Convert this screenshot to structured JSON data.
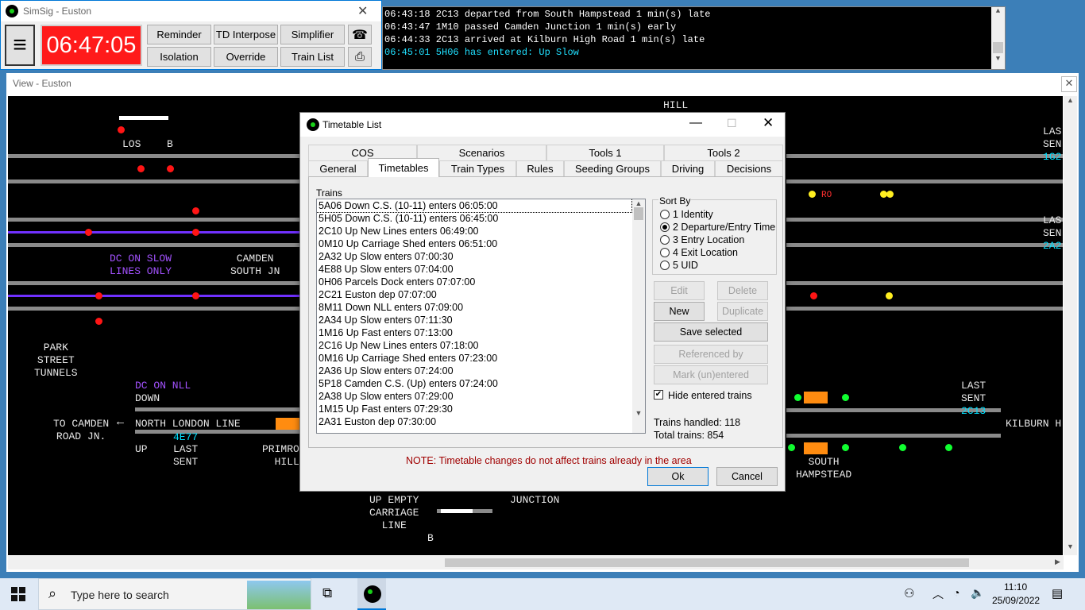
{
  "control": {
    "title": "SimSig - Euston",
    "clock": "06:47:05",
    "buttons": [
      "Reminder",
      "TD Interpose",
      "Simplifier",
      "Isolation",
      "Override",
      "Train List"
    ]
  },
  "log": {
    "lines": [
      {
        "text": "06:43:18 2C13 departed from South Hampstead 1 min(s) late",
        "color": "#ffffff"
      },
      {
        "text": "06:43:47 1M10 passed Camden Junction 1 min(s) early",
        "color": "#ffffff"
      },
      {
        "text": "06:44:33 2C13 arrived at Kilburn High Road 1 min(s) late",
        "color": "#ffffff"
      },
      {
        "text": "06:45:01 5H06 has entered: Up Slow",
        "color": "#20e0ff"
      }
    ]
  },
  "view": {
    "title": "View - Euston",
    "labels": {
      "hill_top": "HILL",
      "los": "LOS",
      "b1": "B",
      "dc_slow": "DC ON SLOW\nLINES ONLY",
      "camden_south": "CAMDEN\nSOUTH JN",
      "park_street": "PARK\nSTREET\nTUNNELS",
      "dc_nll": "DC ON NLL",
      "down": "DOWN",
      "to_camden": "TO CAMDEN\nROAD JN.",
      "arrow": "←",
      "nll": "NORTH LONDON LINE",
      "berth_nll": "4E77",
      "up": "UP",
      "last_sent1": "LAST\nSENT",
      "primrose": "PRIMRO\nHILL",
      "up_empty": "UP EMPTY\nCARRIAGE\nLINE",
      "junction": "JUNCTION",
      "b2": "B",
      "last_sent2": "LAST\nSENT",
      "berth_2c13": "2C13",
      "kilburn": "KILBURN H",
      "south_hampstead": "SOUTH\nHAMPSTEAD",
      "las1": "LAS\nSEN",
      "berth_1g2": "1G2",
      "ro": "RO",
      "las2": "LAS\nSEN",
      "berth_2a2": "2A2"
    }
  },
  "dialog": {
    "title": "Timetable List",
    "tabs_row1": [
      "COS",
      "Scenarios",
      "Tools 1",
      "Tools 2"
    ],
    "tabs_row2": [
      "General",
      "Timetables",
      "Train Types",
      "Rules",
      "Seeding Groups",
      "Driving",
      "Decisions"
    ],
    "trains_label": "Trains",
    "trains": [
      "5A06 Down C.S. (10-11) enters 06:05:00",
      "5H05 Down C.S. (10-11) enters 06:45:00",
      "2C10 Up New Lines enters 06:49:00",
      "0M10 Up Carriage Shed enters 06:51:00",
      "2A32 Up Slow enters 07:00:30",
      "4E88 Up Slow enters 07:04:00",
      "0H06 Parcels Dock enters 07:07:00",
      "2C21 Euston dep 07:07:00",
      "8M11 Down NLL enters 07:09:00",
      "2A34 Up Slow enters 07:11:30",
      "1M16 Up Fast enters 07:13:00",
      "2C16 Up New Lines enters 07:18:00",
      "0M16 Up Carriage Shed enters 07:23:00",
      "2A36 Up Slow enters 07:24:00",
      "5P18 Camden C.S. (Up) enters 07:24:00",
      "2A38 Up Slow enters 07:29:00",
      "1M15 Up Fast enters 07:29:30",
      "2A31 Euston dep 07:30:00"
    ],
    "sort_by": "Sort By",
    "sort_options": [
      "1 Identity",
      "2 Departure/Entry Time",
      "3 Entry Location",
      "4 Exit Location",
      "5 UID"
    ],
    "selected_sort": 1,
    "buttons": {
      "edit": "Edit",
      "delete": "Delete",
      "new": "New",
      "duplicate": "Duplicate",
      "save_selected": "Save selected",
      "referenced_by": "Referenced by",
      "mark_unentered": "Mark (un)entered"
    },
    "hide_entered": "Hide entered trains",
    "hide_entered_checked": true,
    "trains_handled": "Trains handled: 118",
    "total_trains": "Total trains: 854",
    "note": "NOTE: Timetable changes do not affect trains already in the area",
    "ok": "Ok",
    "cancel": "Cancel"
  },
  "taskbar": {
    "search_placeholder": "Type here to search",
    "time": "11:10",
    "date": "25/09/2022"
  }
}
